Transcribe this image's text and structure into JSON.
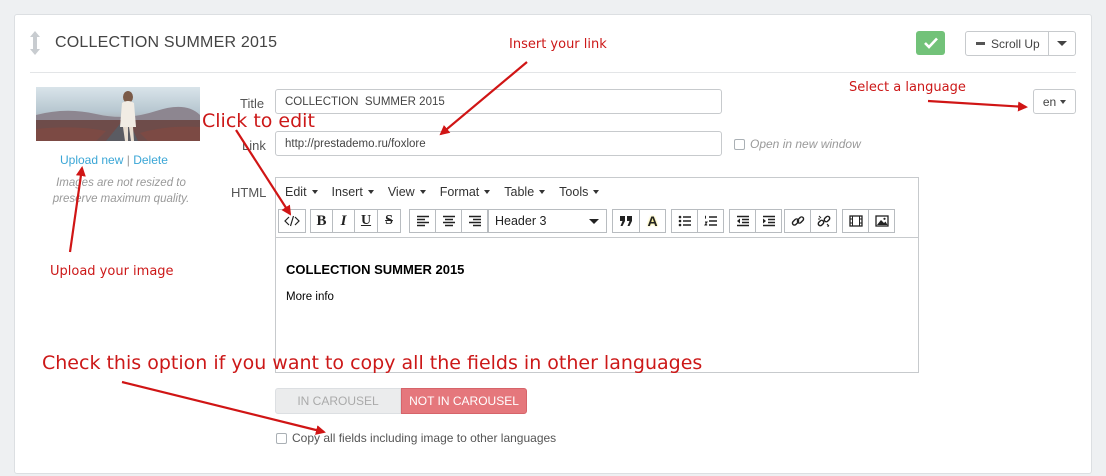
{
  "panel": {
    "title": "COLLECTION SUMMER 2015",
    "scroll_up_label": "Scroll Up"
  },
  "image": {
    "upload_label": "Upload new",
    "separator": "|",
    "delete_label": "Delete",
    "note": "Images are not resized to preserve maximum quality."
  },
  "form": {
    "title_label": "Title",
    "title_value": "COLLECTION  SUMMER 2015",
    "link_label": "Link",
    "link_value": "http://prestademo.ru/foxlore",
    "open_new_window_label": "Open in new window",
    "html_label": "HTML",
    "language_value": "en"
  },
  "editor": {
    "menus": [
      "Edit",
      "Insert",
      "View",
      "Format",
      "Table",
      "Tools"
    ],
    "format_select_value": "Header 3",
    "content_heading": "COLLECTION SUMMER 2015",
    "content_paragraph": "More info"
  },
  "carousel": {
    "in_label": "IN CAROUSEL",
    "not_in_label": "NOT IN CAROUSEL",
    "selected": "NOT IN CAROUSEL"
  },
  "copy_fields_label": "Copy all fields including image to other languages",
  "annotations": {
    "insert_link": "Insert your link",
    "select_language": "Select a language",
    "click_to_edit": "Click to edit",
    "upload_image": "Upload your image",
    "check_option": "Check this option if you want to copy all the fields in other languages"
  },
  "colors": {
    "annotation": "#cc1818",
    "link": "#3aa6d6",
    "success": "#72c279",
    "not_in_carousel": "#e5777c"
  }
}
